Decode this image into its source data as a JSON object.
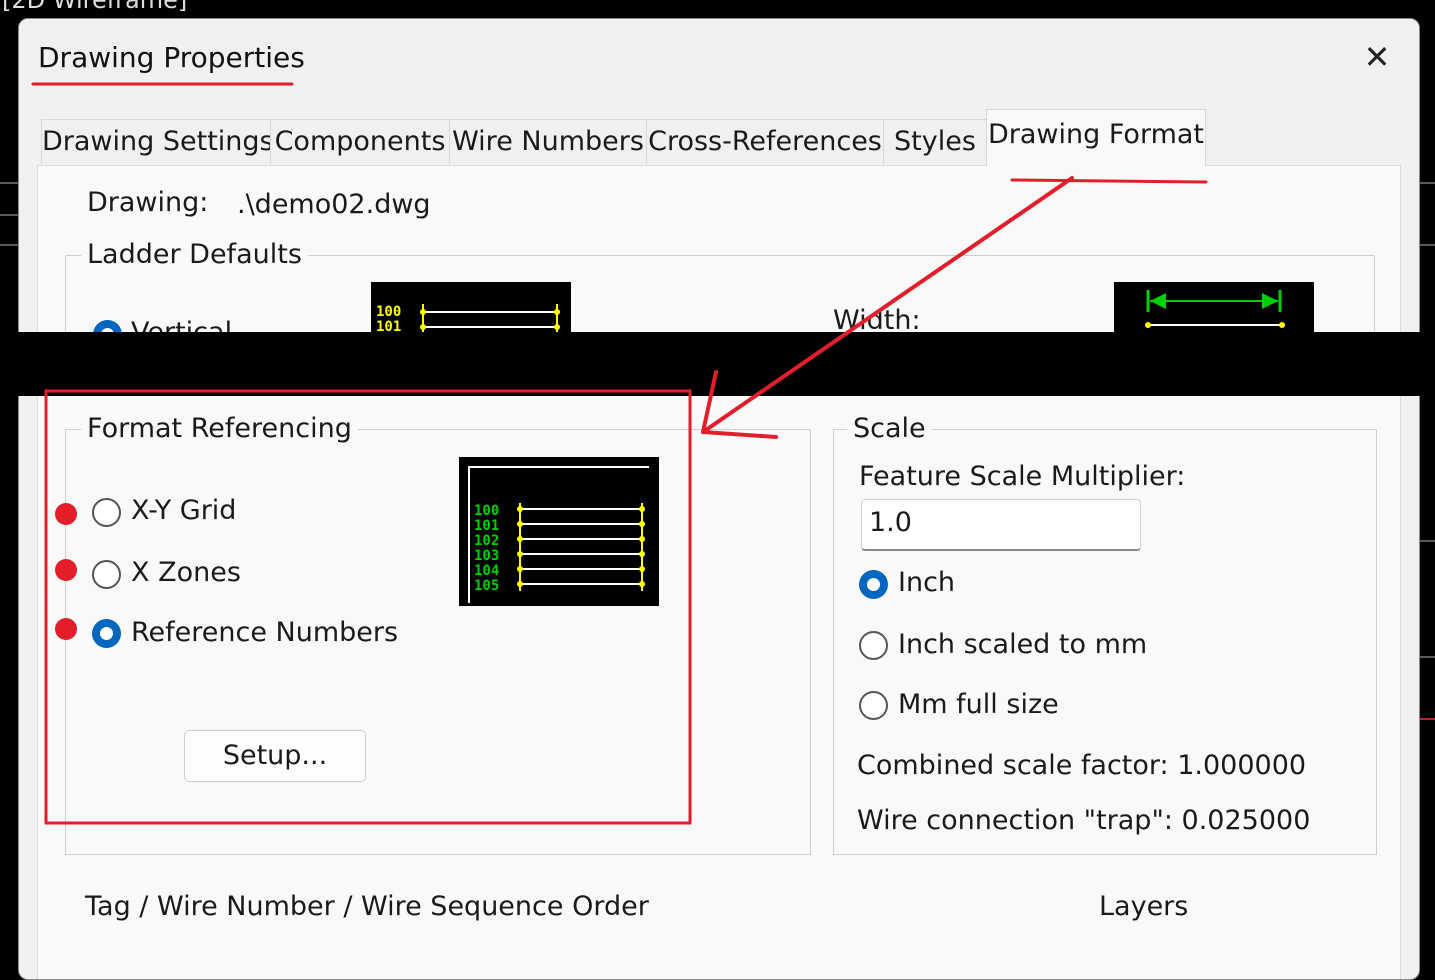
{
  "bg_text": "[2D Wireframe]",
  "dialog": {
    "title": "Drawing Properties",
    "close_glyph": "✕"
  },
  "tabs": [
    "Drawing Settings",
    "Components",
    "Wire Numbers",
    "Cross-References",
    "Styles",
    "Drawing Format"
  ],
  "active_tab": "Drawing Format",
  "drawing": {
    "label": "Drawing:",
    "value": ".\\demo02.dwg"
  },
  "ladder_defaults": {
    "label": "Ladder Defaults",
    "option_vertical": "Vertical",
    "width_label": "Width:",
    "preview_numbers": [
      "100",
      "101"
    ]
  },
  "format_referencing": {
    "label": "Format Referencing",
    "options": [
      "X-Y Grid",
      "X Zones",
      "Reference Numbers"
    ],
    "selected": "Reference Numbers",
    "preview_numbers": [
      "100",
      "101",
      "102",
      "103",
      "104",
      "105"
    ],
    "setup_button": "Setup..."
  },
  "scale": {
    "label": "Scale",
    "multiplier_label": "Feature Scale Multiplier:",
    "multiplier_value": "1.0",
    "options": [
      "Inch",
      "Inch scaled to mm",
      "Mm full size"
    ],
    "selected": "Inch",
    "combined_label": "Combined scale factor: 1.000000",
    "trap_label": "Wire connection \"trap\": 0.025000"
  },
  "bottom": {
    "sequence_label": "Tag / Wire Number / Wire Sequence Order",
    "layers_label": "Layers"
  },
  "colors": {
    "annotation_red": "#e31d2a",
    "radio_selected": "#0067c0",
    "preview_green": "#00d000",
    "preview_yellow": "#ffff00"
  }
}
